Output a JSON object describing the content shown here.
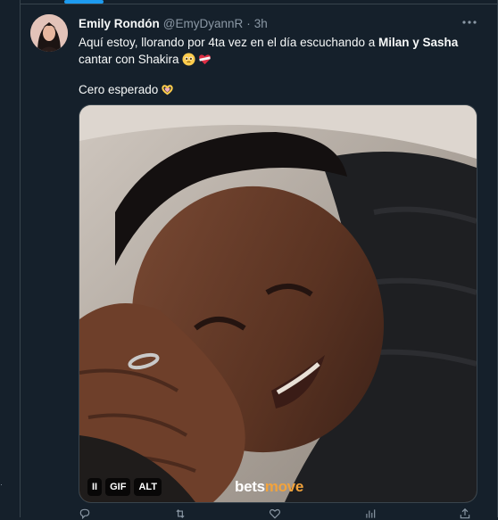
{
  "tweet": {
    "author_name": "Emily Rondón",
    "handle": "@EmyDyannR",
    "separator": "·",
    "time": "3h",
    "text_line1_pre": "Aquí estoy, llorando por 4ta vez en el día escuchando a ",
    "text_line1_bold": "Milan y Sasha",
    "text_line2": "cantar con Shakira",
    "text_line3": "Cero esperado",
    "emojis": [
      "pleading-face-emoji",
      "bandaged-heart-emoji",
      "heart-hands-emoji"
    ]
  },
  "media": {
    "pause_symbol": "II",
    "gif_badge": "GIF",
    "alt_badge": "ALT",
    "watermark_main": "bets",
    "watermark_accent": "move"
  },
  "actions": {
    "reply_count": "",
    "retweet_count": "",
    "like_count": "",
    "views_count": ""
  },
  "colors": {
    "background": "#15202b",
    "text": "#f7f9f9",
    "muted": "#8b98a5",
    "accent": "#1d9bf0",
    "watermark_accent": "#f2a33c"
  }
}
